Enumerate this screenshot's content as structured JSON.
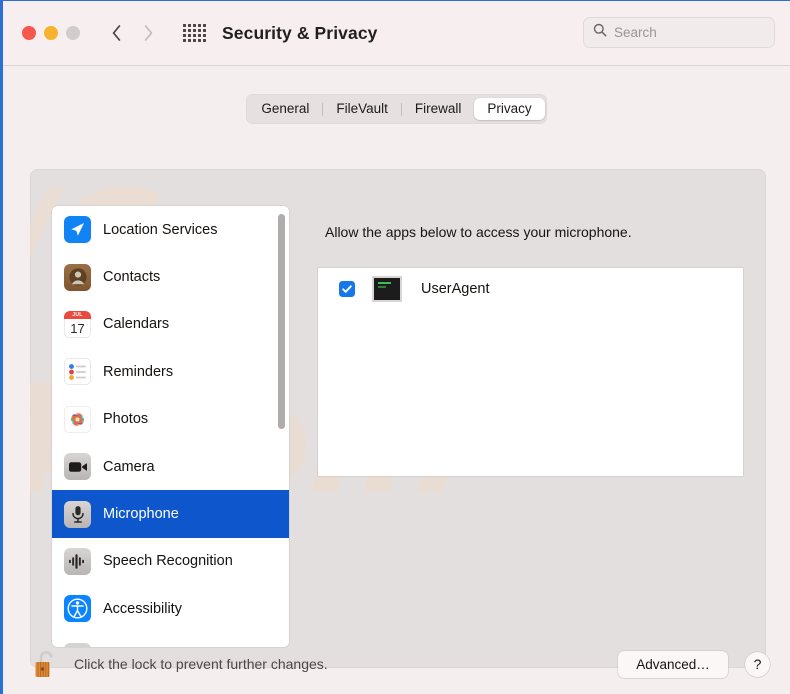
{
  "window": {
    "title": "Security & Privacy",
    "traffic_lights": [
      "close",
      "minimize",
      "zoom"
    ],
    "nav": {
      "back": "back-chevron",
      "forward": "forward-chevron"
    },
    "grid_icon": "show-all-grid-icon"
  },
  "search": {
    "placeholder": "Search",
    "value": "",
    "icon": "search-icon"
  },
  "tabs": [
    {
      "label": "General",
      "selected": false
    },
    {
      "label": "FileVault",
      "selected": false
    },
    {
      "label": "Firewall",
      "selected": false
    },
    {
      "label": "Privacy",
      "selected": true
    }
  ],
  "sidebar": {
    "items": [
      {
        "label": "Location Services",
        "icon": "location-services-icon",
        "selected": false
      },
      {
        "label": "Contacts",
        "icon": "contacts-icon",
        "selected": false
      },
      {
        "label": "Calendars",
        "icon": "calendars-icon",
        "selected": false,
        "badge_month": "JUL",
        "badge_day": "17"
      },
      {
        "label": "Reminders",
        "icon": "reminders-icon",
        "selected": false
      },
      {
        "label": "Photos",
        "icon": "photos-icon",
        "selected": false
      },
      {
        "label": "Camera",
        "icon": "camera-icon",
        "selected": false
      },
      {
        "label": "Microphone",
        "icon": "microphone-icon",
        "selected": true
      },
      {
        "label": "Speech Recognition",
        "icon": "speech-recognition-icon",
        "selected": false
      },
      {
        "label": "Accessibility",
        "icon": "accessibility-icon",
        "selected": false
      }
    ],
    "scrollbar": "vertical-scrollbar"
  },
  "detail": {
    "description": "Allow the apps below to access your microphone.",
    "apps": [
      {
        "name": "UserAgent",
        "checked": true,
        "icon": "terminal-app-icon"
      }
    ]
  },
  "bottom": {
    "lock_icon": "unlocked-padlock-icon",
    "lock_text": "Click the lock to prevent further changes.",
    "advanced_label": "Advanced…",
    "help_label": "?"
  },
  "colors": {
    "accent_blue": "#0d56cc",
    "checkbox_blue": "#1577e8",
    "window_bg": "#f4eeee",
    "panel_bg": "#e3dfdf",
    "list_bg": "#ffffff"
  },
  "watermark": {
    "text": "4.com"
  }
}
